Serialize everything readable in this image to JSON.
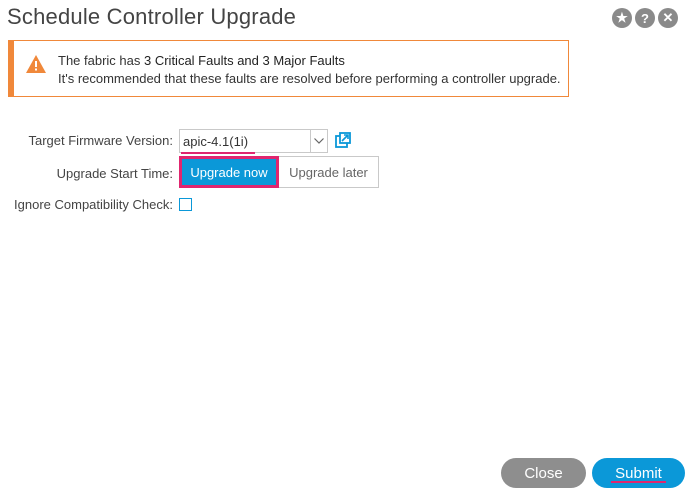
{
  "dialog": {
    "title": "Schedule Controller Upgrade",
    "icons": [
      "star-icon",
      "help-icon",
      "close-icon"
    ]
  },
  "alert": {
    "line1_prefix": "The fabric has ",
    "line1_emphasis": "3 Critical Faults and 3 Major Faults",
    "line2": "It's recommended that these faults are resolved before performing a controller upgrade.",
    "color": "#f0883a"
  },
  "form": {
    "firmware_label": "Target Firmware Version:",
    "firmware_value": "apic-4.1(1i)",
    "start_time_label": "Upgrade Start Time:",
    "upgrade_now_label": "Upgrade now",
    "upgrade_later_label": "Upgrade later",
    "selected_start_time": "Upgrade now",
    "compat_label": "Ignore Compatibility Check:",
    "compat_checked": false
  },
  "footer": {
    "close_label": "Close",
    "submit_label": "Submit"
  },
  "colors": {
    "accent": "#0b98d8",
    "highlight": "#e0266f",
    "neutral_button": "#8e8e8e"
  }
}
